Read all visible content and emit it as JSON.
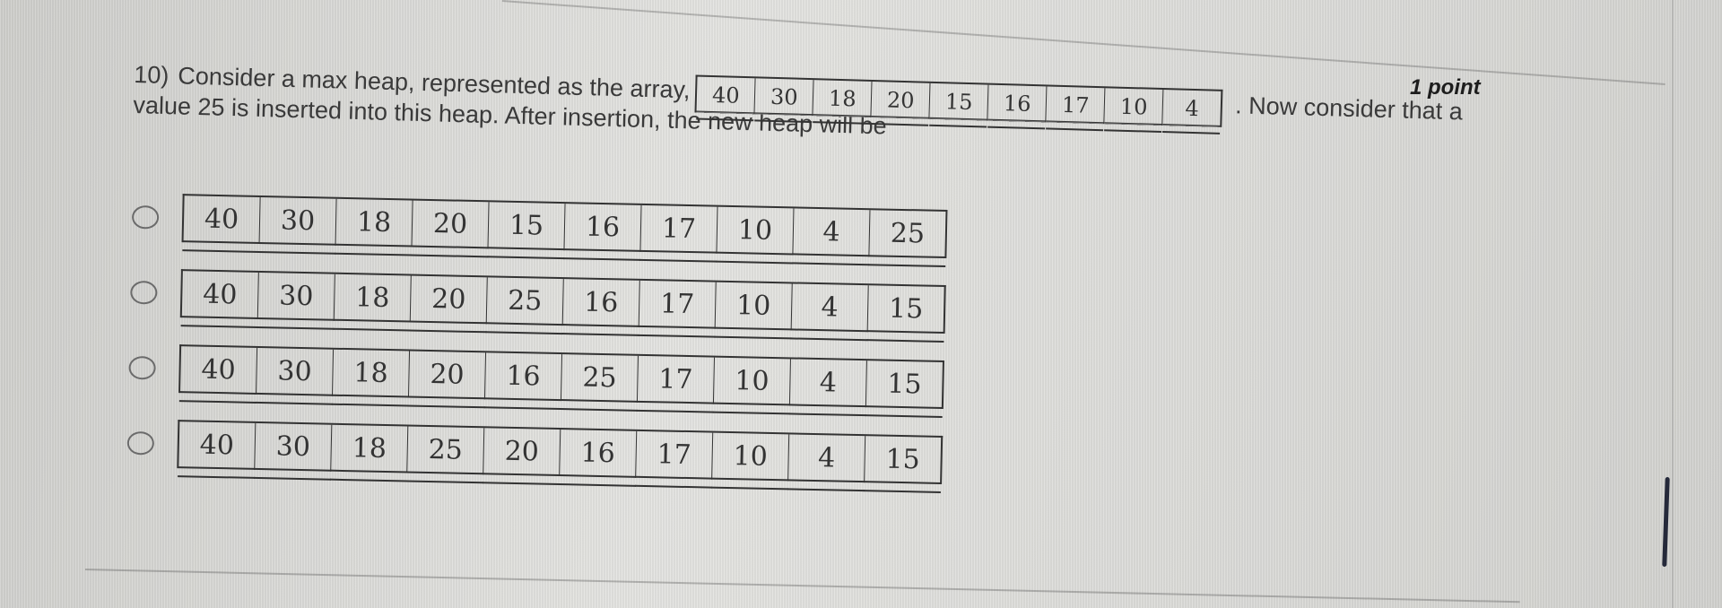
{
  "question": {
    "number": "10)",
    "text_before_array": "Consider a max heap, represented as the array,",
    "initial_array": [
      "40",
      "30",
      "18",
      "20",
      "15",
      "16",
      "17",
      "10",
      "4"
    ],
    "text_after_array": ". Now consider that a",
    "text_line2": "value 25 is inserted into this heap. After insertion, the new heap will be",
    "points_label": "1 point"
  },
  "options": [
    {
      "values": [
        "40",
        "30",
        "18",
        "20",
        "15",
        "16",
        "17",
        "10",
        "4",
        "25"
      ],
      "selected": false
    },
    {
      "values": [
        "40",
        "30",
        "18",
        "20",
        "25",
        "16",
        "17",
        "10",
        "4",
        "15"
      ],
      "selected": false
    },
    {
      "values": [
        "40",
        "30",
        "18",
        "20",
        "16",
        "25",
        "17",
        "10",
        "4",
        "15"
      ],
      "selected": false
    },
    {
      "values": [
        "40",
        "30",
        "18",
        "25",
        "20",
        "16",
        "17",
        "10",
        "4",
        "15"
      ],
      "selected": false
    }
  ]
}
